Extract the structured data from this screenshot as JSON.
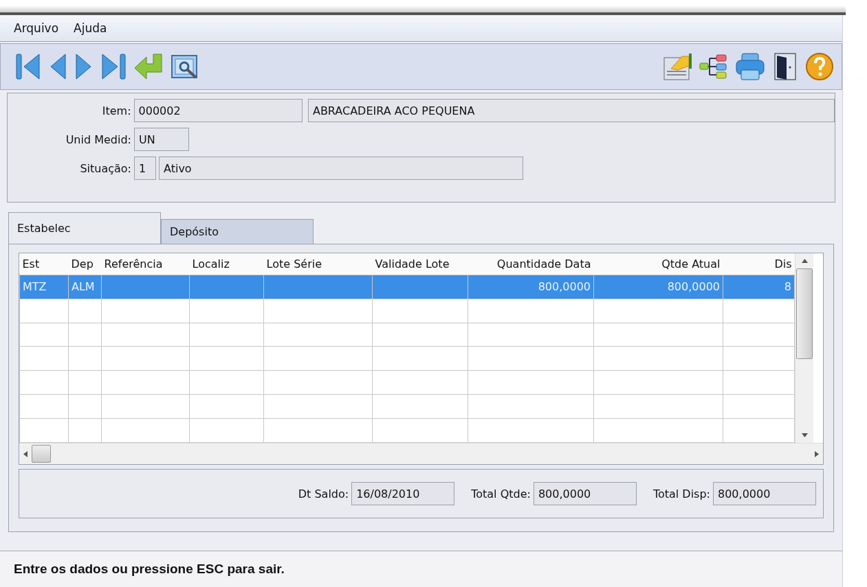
{
  "menu": [
    {
      "label": "Arquivo"
    },
    {
      "label": "Ajuda"
    }
  ],
  "toolbar": {
    "left": [
      {
        "kind": "first"
      },
      {
        "kind": "previous"
      },
      {
        "kind": "next"
      },
      {
        "kind": "last"
      },
      {
        "kind": "enter"
      },
      {
        "kind": "preview"
      }
    ],
    "right": [
      {
        "kind": "report"
      },
      {
        "kind": "tree"
      },
      {
        "kind": "print"
      },
      {
        "kind": "exit"
      },
      {
        "kind": "help"
      }
    ]
  },
  "header": {
    "item": {
      "label": "Item:",
      "code": "000002",
      "description": "ABRACADEIRA ACO PEQUENA"
    },
    "unit": {
      "label": "Unid Medid:",
      "value": "UN"
    },
    "status": {
      "label": "Situação:",
      "code": "1",
      "description": "Ativo"
    }
  },
  "tabs": [
    {
      "label": "Estabelec",
      "selected": true
    },
    {
      "label": "Depósito",
      "selected": false
    }
  ],
  "table": {
    "columns": [
      {
        "label": "Est",
        "kind": "text"
      },
      {
        "label": "Dep",
        "kind": "text"
      },
      {
        "label": "Referência",
        "kind": "text"
      },
      {
        "label": "Localiz",
        "kind": "text"
      },
      {
        "label": "Lote Série",
        "kind": "text"
      },
      {
        "label": "Validade Lote",
        "kind": "text"
      },
      {
        "label": "Quantidade Data",
        "kind": "number"
      },
      {
        "label": "Qtde Atual",
        "kind": "number"
      },
      {
        "label": "Dis",
        "kind": "number"
      }
    ],
    "rows": [
      {
        "selected": true,
        "cells": [
          "MTZ",
          "ALM",
          null,
          null,
          null,
          null,
          "800,0000",
          "800,0000",
          "8"
        ]
      }
    ]
  },
  "totals": [
    {
      "label": "Dt Saldo:",
      "value": "16/08/2010"
    },
    {
      "label": "Total Qtde:",
      "value": "800,0000"
    },
    {
      "label": "Total Disp:",
      "value": "800,0000"
    }
  ],
  "status_bar": "Entre os dados ou pressione ESC para sair."
}
